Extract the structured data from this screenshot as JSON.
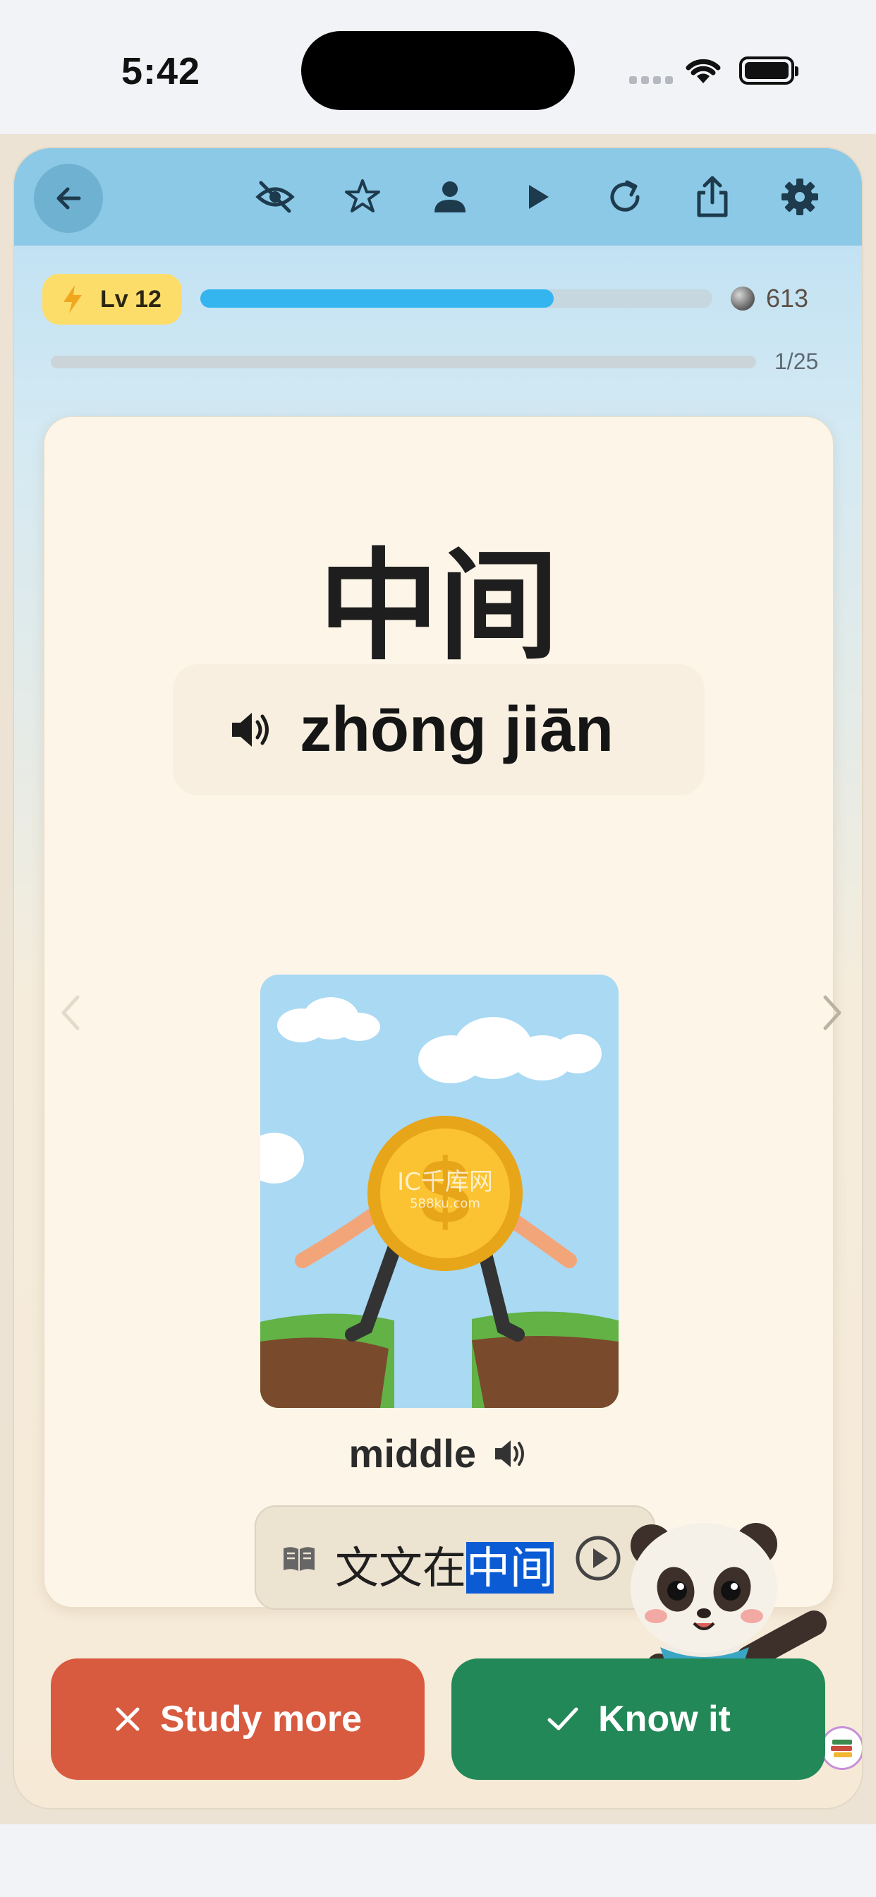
{
  "status_bar": {
    "time": "5:42"
  },
  "toolbar": {
    "icons": [
      "back-arrow-icon",
      "eye-off-icon",
      "star-icon",
      "person-icon",
      "play-icon",
      "refresh-icon",
      "share-icon",
      "gear-icon"
    ]
  },
  "progress": {
    "level_label": "Lv 12",
    "xp_fraction": 0.69,
    "coins": "613",
    "card_counter": "1/25",
    "card_fraction": 0.0
  },
  "card": {
    "hanzi": "中间",
    "pinyin": "zhōng jiān",
    "meaning": "middle",
    "example_before": "文文在",
    "example_highlight": "中间",
    "illustration_watermark": "IC千库网",
    "illustration_watermark_sub": "588ku.com"
  },
  "actions": {
    "study_more_label": "Study more",
    "know_it_label": "Know it"
  },
  "colors": {
    "toolbar": "#8cc9e6",
    "level_badge": "#fddd6a",
    "xp_fill": "#35b5f0",
    "study_more": "#d85a3f",
    "know_it": "#228858",
    "highlight": "#0a5bd4"
  }
}
